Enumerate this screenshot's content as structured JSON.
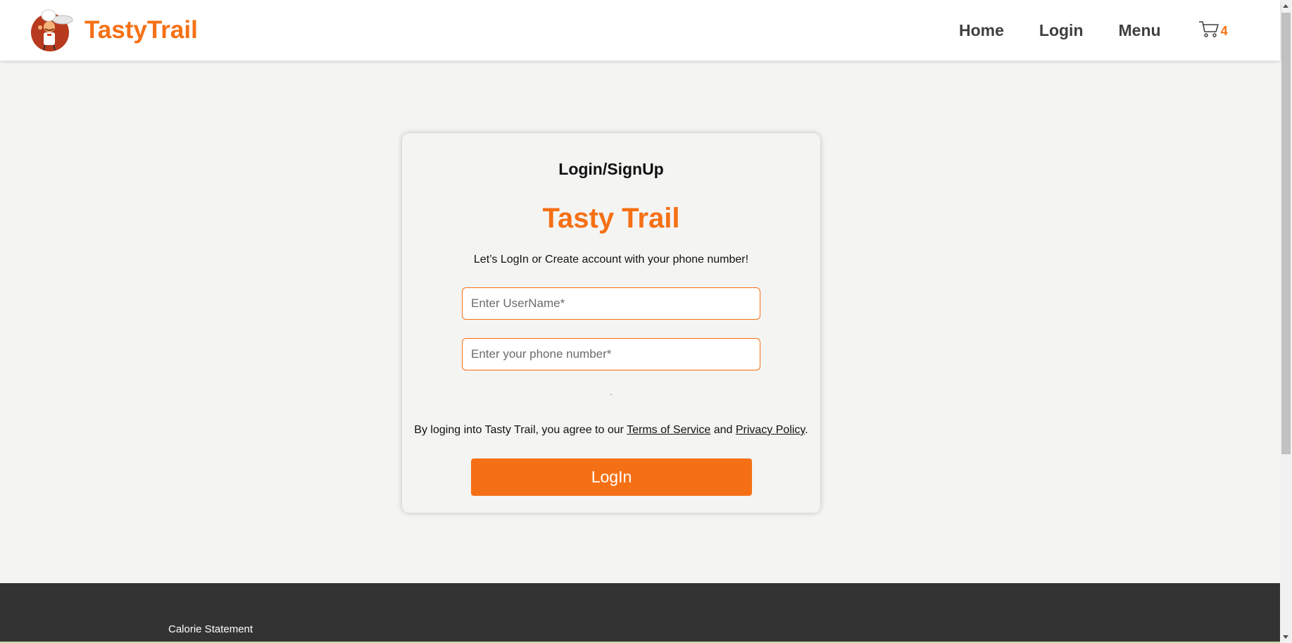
{
  "header": {
    "brand": "TastyTrail",
    "nav": {
      "home": "Home",
      "login": "Login",
      "menu": "Menu"
    },
    "cart": {
      "icon": "cart-icon",
      "count": "4"
    }
  },
  "login_card": {
    "heading": "Login/SignUp",
    "brand": "Tasty Trail",
    "subtitle": "Let’s LogIn or Create account with your phone number!",
    "username": {
      "placeholder": "Enter UserName*",
      "value": ""
    },
    "phone": {
      "placeholder": "Enter your phone number*",
      "value": ""
    },
    "terms": {
      "prefix": "By loging into Tasty Trail, you agree to our ",
      "terms_link": "Terms of Service",
      "middle": " and ",
      "privacy_link": "Privacy Policy",
      "suffix": "."
    },
    "button": "LogIn"
  },
  "footer": {
    "link": "Calorie Statement"
  },
  "colors": {
    "accent": "#f57015",
    "background": "#f4f4f2",
    "footer": "#333333",
    "nav_text": "#3f3f3f"
  }
}
